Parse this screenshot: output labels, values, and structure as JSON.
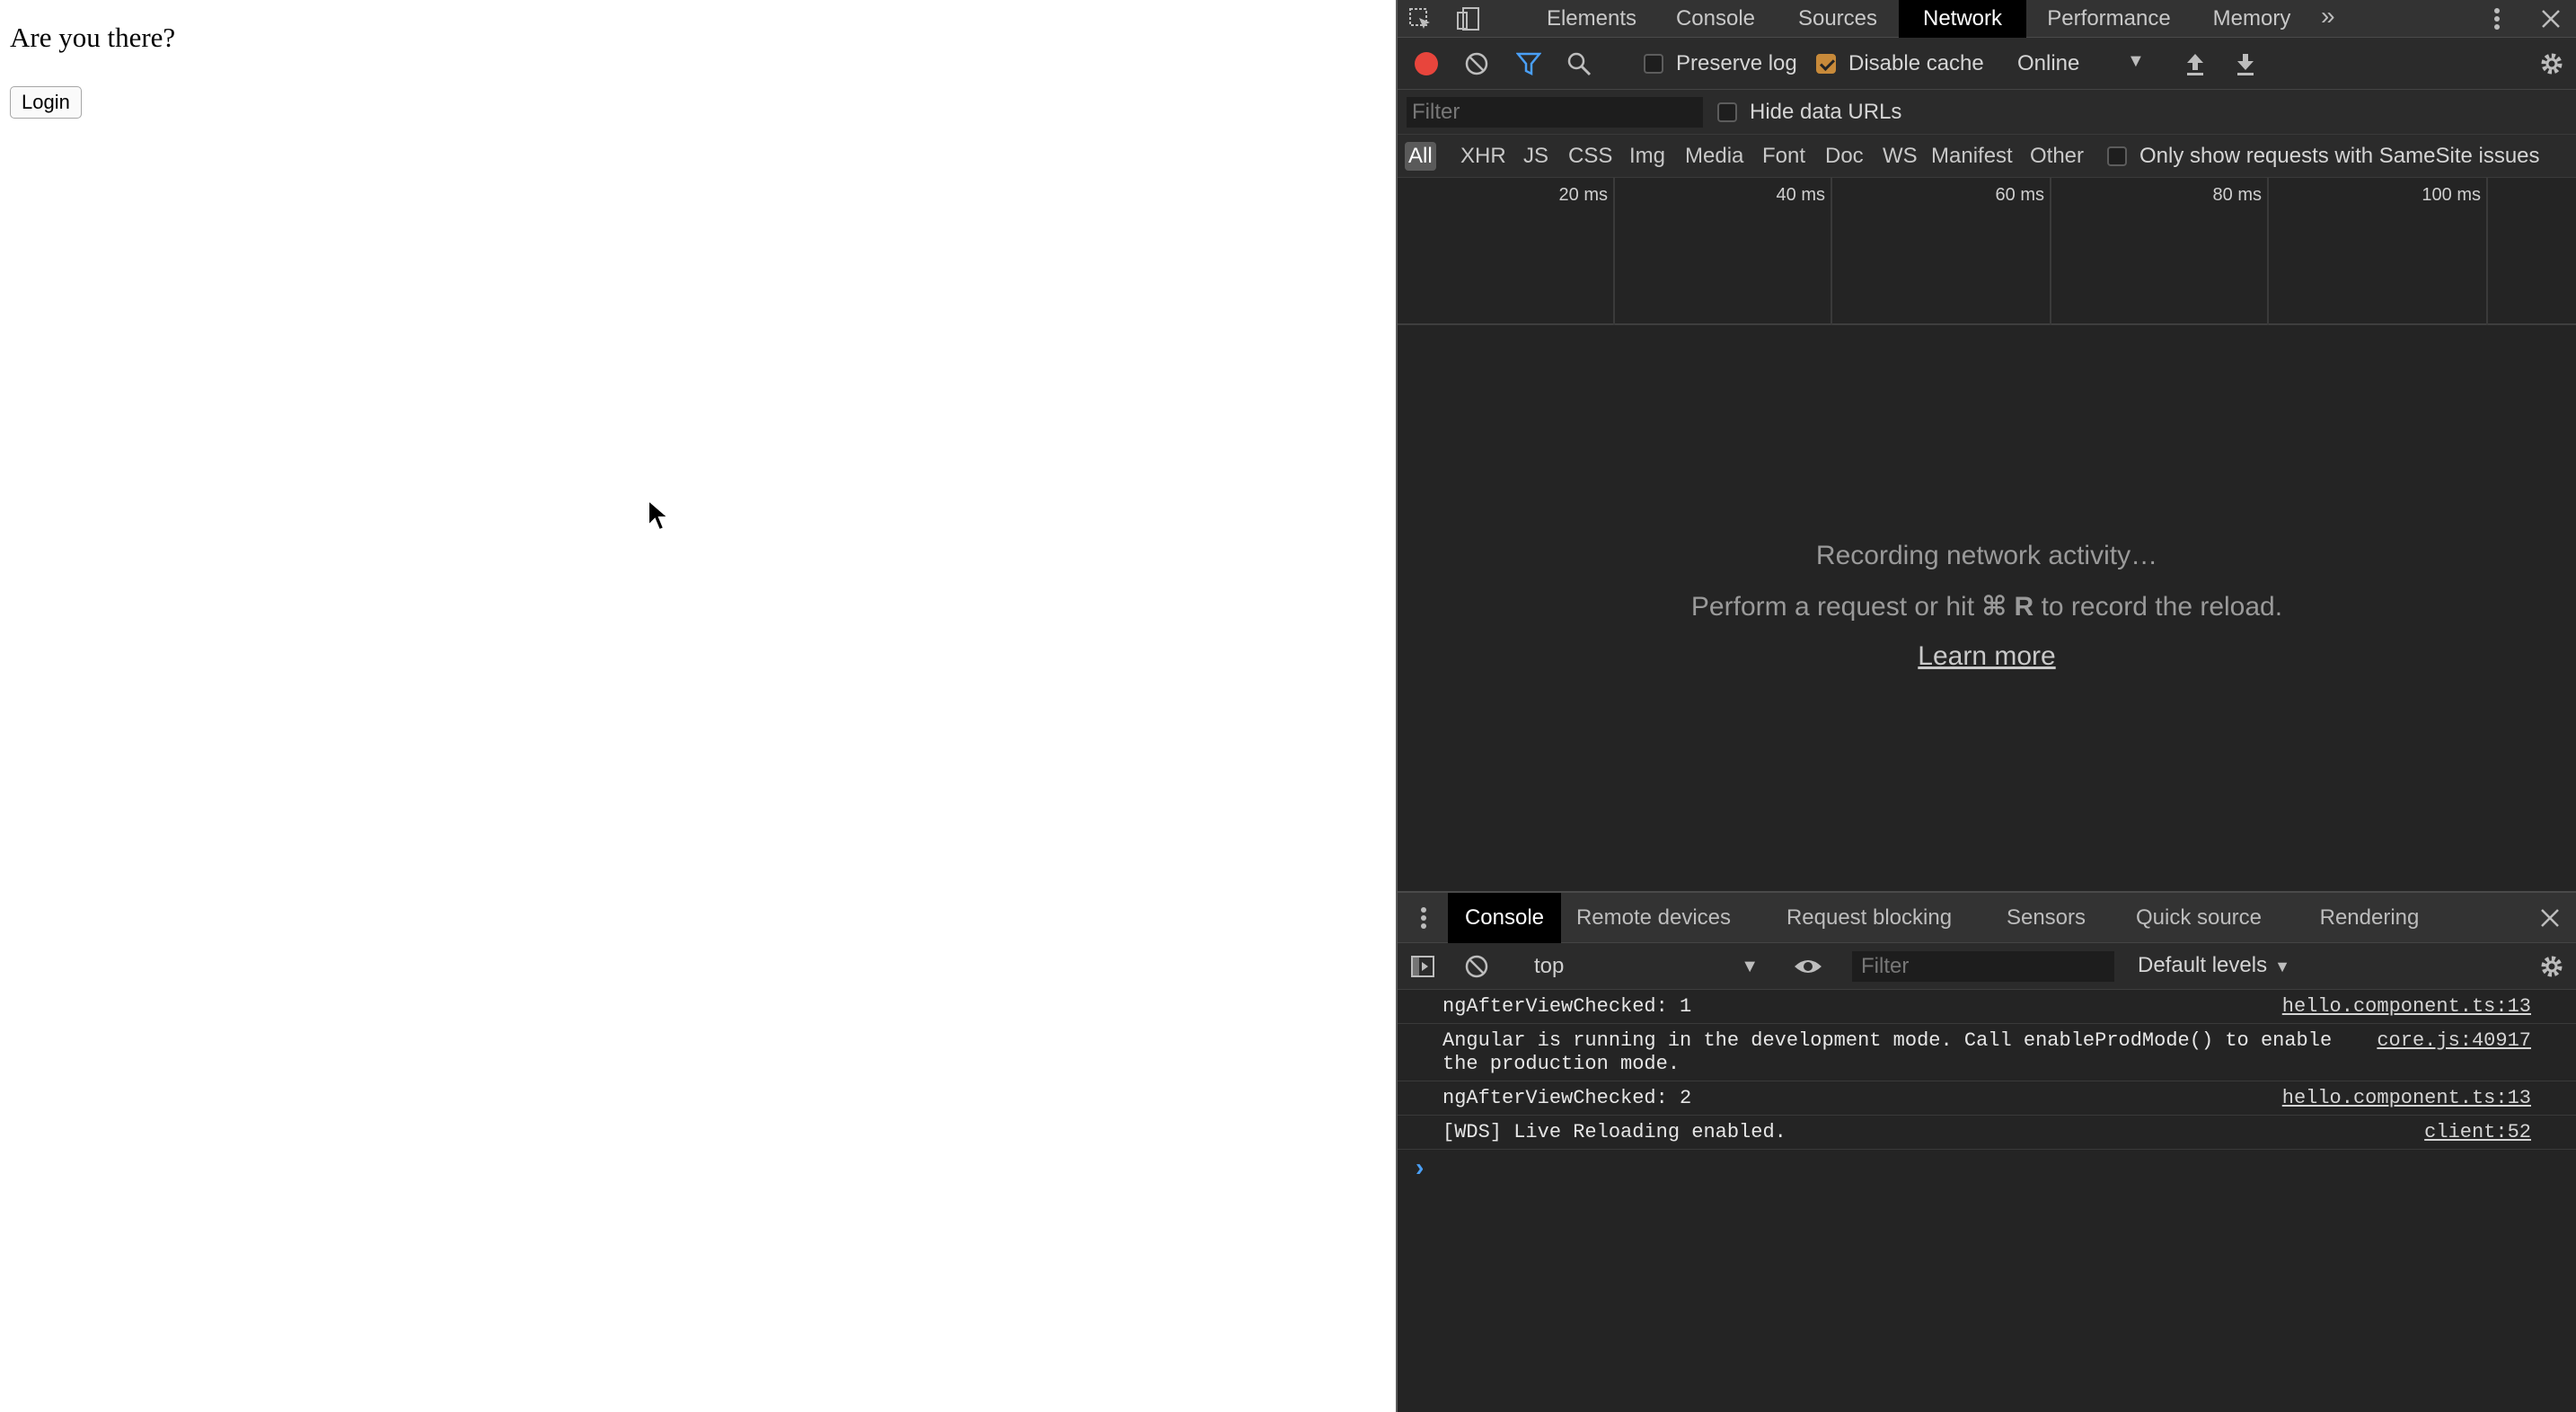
{
  "page": {
    "heading": "Are you there?",
    "login_label": "Login"
  },
  "devtools": {
    "tabs": [
      "Elements",
      "Console",
      "Sources",
      "Network",
      "Performance",
      "Memory"
    ],
    "active_tab": "Network",
    "network_toolbar": {
      "preserve_log": "Preserve log",
      "preserve_log_checked": false,
      "disable_cache": "Disable cache",
      "disable_cache_checked": true,
      "throttling": "Online"
    },
    "filter": {
      "placeholder": "Filter",
      "hide_data_urls": "Hide data URLs"
    },
    "type_filters": [
      "All",
      "XHR",
      "JS",
      "CSS",
      "Img",
      "Media",
      "Font",
      "Doc",
      "WS",
      "Manifest",
      "Other"
    ],
    "active_type": "All",
    "samesite_label": "Only show requests with SameSite issues",
    "timeline_ticks": [
      "20 ms",
      "40 ms",
      "60 ms",
      "80 ms",
      "100 ms"
    ],
    "empty_state": {
      "title": "Recording network activity…",
      "hint_before": "Perform a request or hit ",
      "hint_keys": "⌘ R",
      "hint_after": " to record the reload.",
      "learn_more": "Learn more"
    },
    "drawer_tabs": [
      "Console",
      "Remote devices",
      "Request blocking",
      "Sensors",
      "Quick source",
      "Rendering"
    ],
    "active_drawer_tab": "Console",
    "console_toolbar": {
      "context": "top",
      "filter_placeholder": "Filter",
      "levels": "Default levels"
    },
    "console_messages": [
      {
        "text": "ngAfterViewChecked: 1",
        "source": "hello.component.ts:13"
      },
      {
        "text": "Angular is running in the development mode. Call enableProdMode() to enable\nthe production mode.",
        "source": "core.js:40917"
      },
      {
        "text": "ngAfterViewChecked: 2",
        "source": "hello.component.ts:13"
      },
      {
        "text": "[WDS] Live Reloading enabled.",
        "source": "client:52"
      }
    ],
    "prompt": "›",
    "colors": {
      "record": "#e8453c",
      "filter_icon": "#4a9ff5",
      "checkbox_checked": "#c88a3a",
      "prompt": "#4a9ff5"
    }
  }
}
